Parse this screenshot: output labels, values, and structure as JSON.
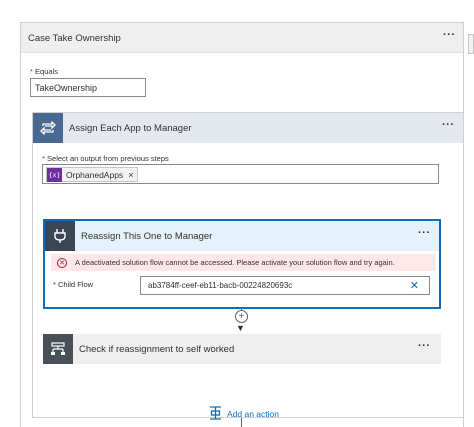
{
  "case": {
    "title": "Case Take Ownership",
    "more_label": "···",
    "equals_label": "Equals",
    "equals_value": "TakeOwnership",
    "required_marker": "*"
  },
  "apply_each": {
    "title": "Assign Each App to Manager",
    "more_label": "···",
    "select_label": "Select an output from previous steps",
    "token": {
      "icon_text": "{x}",
      "label": "OrphanedApps",
      "remove": "×"
    },
    "icon": "loop-icon"
  },
  "child_flow_action": {
    "title": "Reassign This One to Manager",
    "more_label": "···",
    "icon": "plug-icon",
    "error_text": "A deactivated solution flow cannot be accessed. Please activate your solution flow and try again.",
    "error_icon": "error-circle-icon",
    "child_flow_label": "Child Flow",
    "child_flow_value": "ab3784ff-ceef-eb11-bacb-00224820693c",
    "clear": "✕"
  },
  "insert_step": {
    "plus": "+",
    "arrow": "▼"
  },
  "condition": {
    "title": "Check if reassignment to self worked",
    "more_label": "···",
    "icon": "condition-icon"
  },
  "add_action": {
    "label": "Add an action",
    "icon": "add-action-icon"
  },
  "colors": {
    "apply_each_accent": "#486991",
    "child_flow_accent": "#3a4752",
    "selected_border": "#0f6cbd",
    "error_bg": "#fde7e9",
    "token_accent": "#6b2fa0",
    "link": "#0f6cbd"
  }
}
